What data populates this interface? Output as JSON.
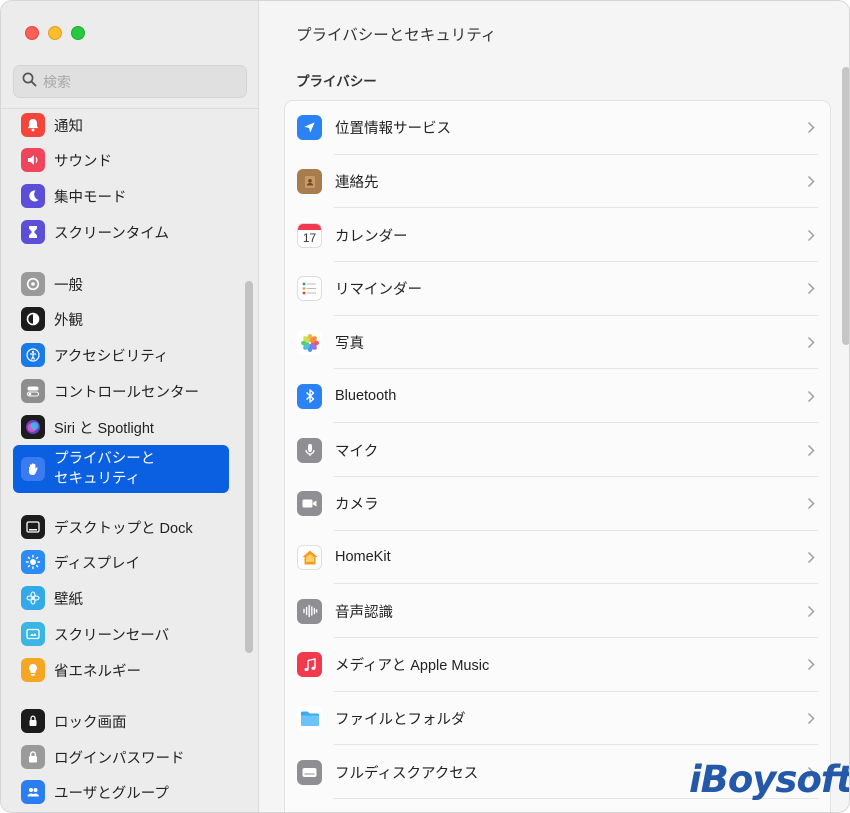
{
  "window": {
    "title": "プライバシーとセキュリティ"
  },
  "search": {
    "placeholder": "検索"
  },
  "sidebar": {
    "items": [
      {
        "label": "通知",
        "icon": "bell-icon",
        "color": "#f4453c"
      },
      {
        "label": "サウンド",
        "icon": "speaker-icon",
        "color": "#f0435c"
      },
      {
        "label": "集中モード",
        "icon": "moon-icon",
        "color": "#5a4fd6"
      },
      {
        "label": "スクリーンタイム",
        "icon": "hourglass-icon",
        "color": "#5a4fd6"
      },
      {
        "label": "一般",
        "icon": "gear-icon",
        "color": "#9a9a9a"
      },
      {
        "label": "外観",
        "icon": "appearance-icon",
        "color": "#1c1c1c"
      },
      {
        "label": "アクセシビリティ",
        "icon": "accessibility-icon",
        "color": "#1a7ae8"
      },
      {
        "label": "コントロールセンター",
        "icon": "toggles-icon",
        "color": "#8e8e8e"
      },
      {
        "label": "Siri と Spotlight",
        "icon": "siri-icon",
        "color": "#6b3fc8"
      },
      {
        "label": "プライバシーと\nセキュリティ",
        "icon": "hand-icon",
        "color": "#3a7cf0"
      },
      {
        "label": "デスクトップと Dock",
        "icon": "dock-icon",
        "color": "#1c1c1c"
      },
      {
        "label": "ディスプレイ",
        "icon": "sun-icon",
        "color": "#2b8cf5"
      },
      {
        "label": "壁紙",
        "icon": "flower-icon",
        "color": "#32a9e8"
      },
      {
        "label": "スクリーンセーバ",
        "icon": "screensaver-icon",
        "color": "#39b6e4"
      },
      {
        "label": "省エネルギー",
        "icon": "bulb-icon",
        "color": "#f5a623"
      },
      {
        "label": "ロック画面",
        "icon": "lock-screen-icon",
        "color": "#1c1c1c"
      },
      {
        "label": "ログインパスワード",
        "icon": "lock-icon",
        "color": "#9a9a9a"
      },
      {
        "label": "ユーザとグループ",
        "icon": "users-icon",
        "color": "#2b7ef0"
      }
    ]
  },
  "main": {
    "section": "プライバシー",
    "rows": [
      {
        "label": "位置情報サービス",
        "icon": "location-arrow-icon",
        "color": "#2a82f5"
      },
      {
        "label": "連絡先",
        "icon": "contacts-icon",
        "color": "#a97c4e"
      },
      {
        "label": "カレンダー",
        "icon": "calendar-icon",
        "color": "#ffffff",
        "day": "17"
      },
      {
        "label": "リマインダー",
        "icon": "reminders-icon",
        "color": "#ffffff"
      },
      {
        "label": "写真",
        "icon": "photos-icon",
        "color": "#ffffff"
      },
      {
        "label": "Bluetooth",
        "icon": "bluetooth-icon",
        "color": "#2a82f5"
      },
      {
        "label": "マイク",
        "icon": "microphone-icon",
        "color": "#8e8e93"
      },
      {
        "label": "カメラ",
        "icon": "camera-icon",
        "color": "#8e8e93"
      },
      {
        "label": "HomeKit",
        "icon": "home-icon",
        "color": "#ffffff"
      },
      {
        "label": "音声認識",
        "icon": "waveform-icon",
        "color": "#8e8e93"
      },
      {
        "label": "メディアと Apple Music",
        "icon": "music-icon",
        "color": "#f2394e"
      },
      {
        "label": "ファイルとフォルダ",
        "icon": "folder-icon",
        "color": "#3ea8f0"
      },
      {
        "label": "フルディスクアクセス",
        "icon": "disk-icon",
        "color": "#8e8e93"
      }
    ]
  },
  "watermark": {
    "text": "iBoysoft",
    "color": "#2458a8"
  }
}
